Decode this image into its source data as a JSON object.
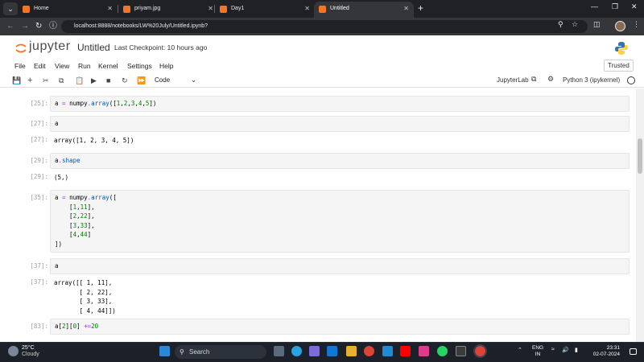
{
  "browser": {
    "tabs": [
      {
        "title": "Home",
        "favicon_color": "#f37626"
      },
      {
        "title": "priyam.jpg",
        "favicon_color": "#f37626"
      },
      {
        "title": "Day1",
        "favicon_color": "#f37626"
      },
      {
        "title": "Untitled",
        "favicon_color": "#f37626",
        "active": true
      }
    ],
    "url": "localhost:8888/notebooks/LW%20July/Untitled.ipynb?"
  },
  "jupyter": {
    "wordmark": "jupyter",
    "notebook_title": "Untitled",
    "checkpoint": "Last Checkpoint: 10 hours ago",
    "trusted": "Trusted",
    "menu": [
      "File",
      "Edit",
      "View",
      "Run",
      "Kernel",
      "Settings",
      "Help"
    ],
    "toolbar": {
      "cell_type": "Code",
      "jupyterlab_label": "JupyterLab",
      "kernel_label": "Python 3 (ipykernel)"
    }
  },
  "cells": [
    {
      "prompt": "[25]:",
      "source": "a = numpy.array([1,2,3,4,5])"
    },
    {
      "prompt": "[27]:",
      "source": "a",
      "out_prompt": "[27]:",
      "output": "array([1, 2, 3, 4, 5])"
    },
    {
      "prompt": "[29]:",
      "source": "a.shape",
      "out_prompt": "[29]:",
      "output": "(5,)"
    },
    {
      "prompt": "[35]:",
      "source_lines": [
        "a = numpy.array([",
        "    [1,11],",
        "    [2,22],",
        "    [3,33],",
        "    [4,44]",
        "])"
      ]
    },
    {
      "prompt": "[37]:",
      "source": "a",
      "out_prompt": "[37]:",
      "output_lines": [
        "array([[ 1, 11],",
        "       [ 2, 22],",
        "       [ 3, 33],",
        "       [ 4, 44]])"
      ]
    },
    {
      "prompt": "[83]:",
      "source": "a[2][0] +=20"
    }
  ],
  "taskbar": {
    "temperature": "25°C",
    "condition": "Cloudy",
    "search_placeholder": "Search",
    "lang_line1": "ENG",
    "lang_line2": "IN",
    "time": "23:31",
    "date": "02-07-2024"
  }
}
